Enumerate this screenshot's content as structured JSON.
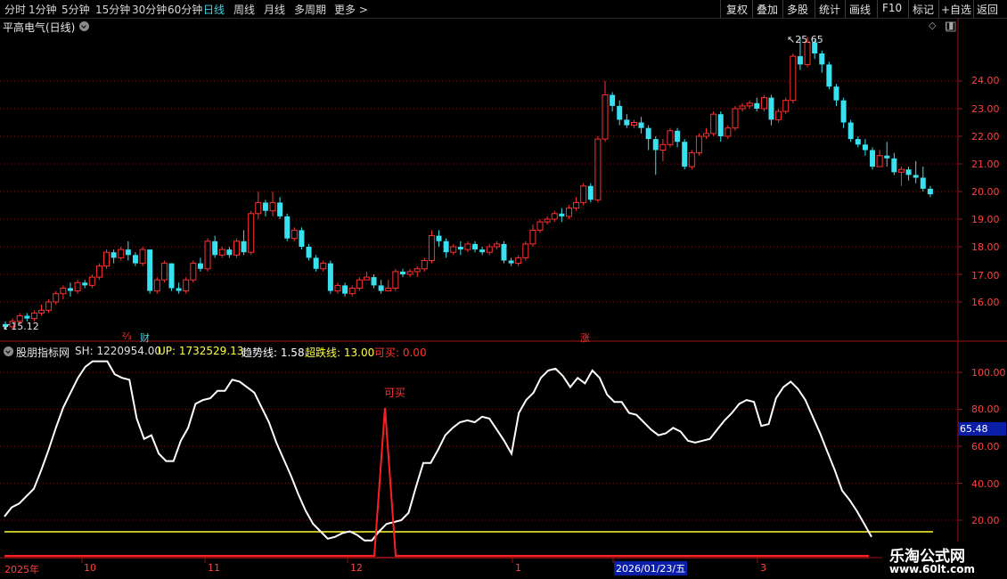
{
  "toolbar": {
    "periods": [
      "分时",
      "1分钟",
      "5分钟",
      "15分钟",
      "30分钟",
      "60分钟",
      "日线",
      "周线",
      "月线",
      "多周期",
      "更多"
    ],
    "active_index": 6,
    "right_buttons": [
      "复权",
      "叠加",
      "多股",
      "统计",
      "画线",
      "F10",
      "标记",
      "+自选",
      "返回"
    ]
  },
  "price_panel": {
    "title": "平高电气(日线)",
    "high_label": "25.65",
    "low_label": "15.12",
    "y_ticks": [
      "24.00",
      "23.00",
      "22.00",
      "21.00",
      "20.00",
      "19.00",
      "18.00",
      "17.00",
      "16.00"
    ],
    "markers": [
      {
        "text": "⅔",
        "color": "#ff3030"
      },
      {
        "text": "财",
        "color": "#38d8e8"
      },
      {
        "text": "涨",
        "color": "#ff3030"
      }
    ]
  },
  "indicator_panel": {
    "name": "股朋指标网",
    "items": [
      {
        "label": "SH: 1220954.00",
        "color": "#e0e0e0"
      },
      {
        "label": "UP: 1732529.13",
        "color": "#ffff40"
      },
      {
        "label": "趋势线: 1.58",
        "color": "#ffffff"
      },
      {
        "label": "超跌线: 13.00",
        "color": "#ffff40"
      },
      {
        "label": "可买: 0.00",
        "color": "#ff3030"
      }
    ],
    "signal_label": "可买",
    "current_value": "65.48",
    "y_ticks": [
      "100.00",
      "80.00",
      "60.00",
      "40.00",
      "20.00"
    ]
  },
  "time_axis": {
    "labels": [
      "2025年",
      "10",
      "11",
      "12",
      "1",
      "2026/01/23/五",
      "3"
    ]
  },
  "watermark": {
    "title": "乐淘公式网",
    "url": "www.60lt.com"
  },
  "chart_data": {
    "type": "candlestick",
    "y_range": [
      15.0,
      26.0
    ],
    "candles": [
      [
        15.2,
        15.1,
        15.3,
        15.0
      ],
      [
        15.1,
        15.3,
        15.4,
        15.0
      ],
      [
        15.3,
        15.5,
        15.6,
        15.2
      ],
      [
        15.5,
        15.4,
        15.6,
        15.3
      ],
      [
        15.4,
        15.6,
        15.7,
        15.3
      ],
      [
        15.6,
        15.7,
        15.9,
        15.5
      ],
      [
        15.7,
        16.0,
        16.1,
        15.6
      ],
      [
        16.0,
        16.3,
        16.4,
        15.9
      ],
      [
        16.3,
        16.5,
        16.6,
        16.1
      ],
      [
        16.5,
        16.4,
        16.7,
        16.2
      ],
      [
        16.4,
        16.7,
        16.8,
        16.3
      ],
      [
        16.7,
        16.6,
        16.8,
        16.5
      ],
      [
        16.6,
        16.9,
        17.0,
        16.5
      ],
      [
        16.9,
        17.3,
        17.4,
        16.8
      ],
      [
        17.3,
        17.8,
        17.9,
        17.2
      ],
      [
        17.8,
        17.6,
        17.9,
        17.4
      ],
      [
        17.6,
        17.9,
        18.0,
        17.5
      ],
      [
        17.9,
        17.7,
        18.2,
        17.5
      ],
      [
        17.7,
        17.4,
        17.8,
        17.3
      ],
      [
        17.4,
        17.9,
        18.0,
        17.3
      ],
      [
        17.9,
        16.4,
        17.9,
        16.3
      ],
      [
        16.4,
        16.8,
        16.9,
        16.3
      ],
      [
        16.8,
        17.4,
        17.5,
        16.7
      ],
      [
        17.4,
        16.5,
        17.4,
        16.4
      ],
      [
        16.5,
        16.4,
        16.7,
        16.3
      ],
      [
        16.4,
        16.8,
        16.9,
        16.3
      ],
      [
        16.8,
        17.4,
        17.5,
        16.7
      ],
      [
        17.4,
        17.2,
        17.6,
        17.1
      ],
      [
        17.2,
        18.2,
        18.3,
        17.1
      ],
      [
        18.2,
        17.7,
        18.4,
        17.6
      ],
      [
        17.7,
        17.9,
        18.0,
        17.6
      ],
      [
        17.9,
        17.7,
        18.0,
        17.6
      ],
      [
        17.7,
        18.2,
        18.3,
        17.6
      ],
      [
        18.2,
        17.8,
        18.6,
        17.7
      ],
      [
        17.8,
        19.2,
        19.3,
        17.7
      ],
      [
        19.2,
        19.6,
        20.0,
        19.0
      ],
      [
        19.6,
        19.3,
        19.7,
        19.1
      ],
      [
        19.3,
        19.6,
        20.0,
        19.1
      ],
      [
        19.6,
        19.1,
        19.8,
        19.0
      ],
      [
        19.1,
        18.3,
        19.2,
        18.2
      ],
      [
        18.3,
        18.6,
        18.7,
        18.2
      ],
      [
        18.6,
        18.0,
        18.7,
        17.9
      ],
      [
        18.0,
        17.6,
        18.1,
        17.5
      ],
      [
        17.6,
        17.2,
        17.7,
        17.1
      ],
      [
        17.2,
        17.4,
        17.5,
        17.1
      ],
      [
        17.4,
        16.4,
        17.5,
        16.3
      ],
      [
        16.4,
        16.6,
        16.7,
        16.3
      ],
      [
        16.6,
        16.3,
        16.7,
        16.2
      ],
      [
        16.3,
        16.5,
        16.6,
        16.2
      ],
      [
        16.5,
        16.8,
        16.9,
        16.4
      ],
      [
        16.8,
        16.9,
        17.1,
        16.8
      ],
      [
        16.9,
        16.6,
        17.0,
        16.5
      ],
      [
        16.6,
        16.4,
        16.8,
        16.3
      ],
      [
        16.4,
        16.5,
        16.8,
        16.4
      ],
      [
        16.5,
        17.1,
        17.2,
        16.4
      ],
      [
        17.1,
        17.0,
        17.2,
        16.9
      ],
      [
        17.0,
        17.1,
        17.2,
        16.9
      ],
      [
        17.1,
        17.2,
        17.3,
        16.9
      ],
      [
        17.2,
        17.5,
        17.6,
        17.1
      ],
      [
        17.5,
        18.4,
        18.6,
        17.4
      ],
      [
        18.4,
        18.2,
        18.6,
        18.0
      ],
      [
        18.2,
        17.8,
        18.3,
        17.6
      ],
      [
        17.8,
        18.0,
        18.1,
        17.7
      ],
      [
        18.0,
        17.9,
        18.2,
        17.7
      ],
      [
        17.9,
        18.1,
        18.2,
        17.8
      ],
      [
        18.1,
        17.9,
        18.2,
        17.8
      ],
      [
        17.9,
        17.8,
        18.0,
        17.7
      ],
      [
        17.8,
        18.0,
        18.1,
        17.7
      ],
      [
        18.0,
        18.1,
        18.2,
        17.9
      ],
      [
        18.1,
        17.5,
        18.2,
        17.4
      ],
      [
        17.5,
        17.4,
        17.6,
        17.3
      ],
      [
        17.4,
        17.6,
        17.7,
        17.3
      ],
      [
        17.6,
        18.1,
        18.2,
        17.5
      ],
      [
        18.1,
        18.6,
        18.8,
        18.0
      ],
      [
        18.6,
        18.9,
        19.0,
        18.5
      ],
      [
        18.9,
        19.0,
        19.1,
        18.8
      ],
      [
        19.0,
        19.2,
        19.3,
        18.9
      ],
      [
        19.2,
        19.1,
        19.4,
        18.9
      ],
      [
        19.1,
        19.4,
        19.5,
        19.0
      ],
      [
        19.4,
        19.6,
        19.8,
        19.3
      ],
      [
        19.6,
        20.2,
        20.3,
        19.5
      ],
      [
        20.2,
        19.7,
        20.3,
        19.6
      ],
      [
        19.7,
        21.9,
        22.0,
        19.6
      ],
      [
        21.9,
        23.5,
        24.0,
        21.8
      ],
      [
        23.5,
        23.1,
        23.6,
        22.9
      ],
      [
        23.1,
        22.6,
        23.3,
        22.4
      ],
      [
        22.6,
        22.4,
        22.8,
        22.3
      ],
      [
        22.4,
        22.5,
        22.6,
        22.3
      ],
      [
        22.5,
        22.3,
        22.7,
        22.1
      ],
      [
        22.3,
        21.9,
        22.4,
        21.5
      ],
      [
        21.9,
        21.5,
        22.0,
        20.6
      ],
      [
        21.5,
        21.7,
        21.9,
        21.1
      ],
      [
        21.7,
        22.2,
        22.3,
        21.6
      ],
      [
        22.2,
        21.8,
        22.3,
        21.6
      ],
      [
        21.8,
        20.9,
        21.9,
        20.8
      ],
      [
        20.9,
        21.4,
        21.5,
        20.8
      ],
      [
        21.4,
        22.0,
        22.1,
        21.3
      ],
      [
        22.0,
        22.1,
        22.3,
        21.9
      ],
      [
        22.1,
        22.8,
        22.9,
        22.0
      ],
      [
        22.8,
        22.0,
        22.9,
        21.8
      ],
      [
        22.0,
        22.3,
        22.4,
        21.9
      ],
      [
        22.3,
        23.0,
        23.1,
        22.2
      ],
      [
        23.0,
        23.1,
        23.2,
        22.9
      ],
      [
        23.1,
        23.2,
        23.3,
        23.0
      ],
      [
        23.2,
        23.0,
        23.4,
        22.9
      ],
      [
        23.0,
        23.4,
        23.5,
        22.9
      ],
      [
        23.4,
        22.6,
        23.5,
        22.4
      ],
      [
        22.6,
        22.9,
        23.0,
        22.5
      ],
      [
        22.9,
        23.3,
        23.4,
        22.8
      ],
      [
        23.3,
        24.9,
        25.0,
        23.2
      ],
      [
        24.9,
        24.6,
        25.6,
        24.4
      ],
      [
        24.6,
        25.4,
        25.6,
        24.5
      ],
      [
        25.4,
        25.0,
        25.5,
        24.8
      ],
      [
        25.0,
        24.6,
        25.1,
        24.3
      ],
      [
        24.6,
        23.8,
        24.7,
        23.7
      ],
      [
        23.8,
        23.3,
        23.9,
        23.1
      ],
      [
        23.3,
        22.5,
        23.4,
        22.3
      ],
      [
        22.5,
        21.9,
        22.6,
        21.8
      ],
      [
        21.9,
        21.7,
        22.0,
        21.6
      ],
      [
        21.7,
        21.5,
        21.9,
        21.3
      ],
      [
        21.5,
        20.9,
        21.6,
        20.8
      ],
      [
        20.9,
        21.3,
        21.5,
        20.9
      ],
      [
        21.3,
        21.2,
        21.8,
        20.9
      ],
      [
        21.2,
        20.7,
        21.4,
        20.6
      ],
      [
        20.7,
        20.8,
        20.9,
        20.2
      ],
      [
        20.8,
        20.6,
        20.9,
        20.4
      ],
      [
        20.6,
        20.5,
        21.1,
        20.3
      ],
      [
        20.5,
        20.1,
        20.9,
        20.0
      ],
      [
        20.1,
        19.9,
        20.2,
        19.8
      ]
    ],
    "indicator": {
      "name": "趋势线",
      "y_range": [
        0,
        110
      ],
      "values": [
        22,
        27,
        29,
        33,
        37,
        47,
        58,
        70,
        81,
        89,
        97,
        103,
        106,
        106,
        106,
        99,
        97,
        96,
        75,
        64,
        66,
        56,
        52,
        52,
        63,
        70,
        83,
        85,
        86,
        90,
        90,
        96,
        95,
        92,
        89,
        81,
        73,
        62,
        53,
        44,
        34,
        25,
        18,
        14,
        10,
        11,
        13,
        14,
        12,
        9,
        9,
        14,
        18,
        19,
        20,
        24,
        38,
        51,
        51,
        58,
        66,
        70,
        73,
        74,
        73,
        76,
        75,
        69,
        63,
        56,
        78,
        85,
        89,
        97,
        101,
        102,
        98,
        92,
        97,
        94,
        101,
        97,
        88,
        84,
        84,
        78,
        77,
        73,
        69,
        66,
        67,
        70,
        68,
        63,
        62,
        63,
        64,
        69,
        74,
        78,
        83,
        85,
        84,
        71,
        72,
        86,
        92,
        95,
        91,
        85,
        76,
        67,
        57,
        47,
        36,
        31,
        25,
        18,
        11
      ]
    }
  }
}
